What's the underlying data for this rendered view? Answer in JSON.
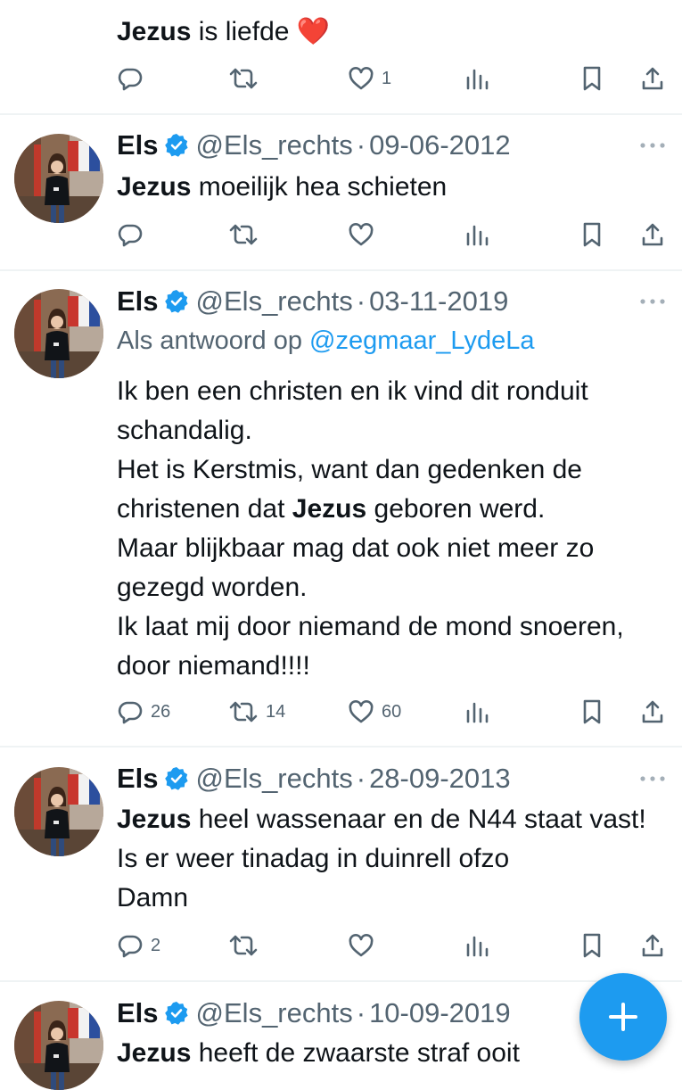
{
  "tweets": [
    {
      "text_parts": [
        {
          "b": "Jezus"
        },
        {
          "t": " is liefde "
        }
      ],
      "emoji": "❤️",
      "counts": {
        "reply": "",
        "retweet": "",
        "like": "1"
      }
    },
    {
      "name": "Els",
      "handle": "@Els_rechts",
      "dot": "·",
      "date": "09-06-2012",
      "text_parts": [
        {
          "b": "Jezus"
        },
        {
          "t": " moeilijk hea schieten"
        }
      ],
      "counts": {
        "reply": "",
        "retweet": "",
        "like": ""
      }
    },
    {
      "name": "Els",
      "handle": "@Els_rechts",
      "dot": "·",
      "date": "03-11-2019",
      "reply_prefix": "Als antwoord op ",
      "reply_to": "@zegmaar_LydeLa",
      "text_parts": [
        {
          "t": "Ik ben een christen en ik vind dit ronduit schandalig."
        },
        {
          "br": true
        },
        {
          "t": "Het is Kerstmis, want dan gedenken de christenen dat "
        },
        {
          "b": "Jezus"
        },
        {
          "t": " geboren werd."
        },
        {
          "br": true
        },
        {
          "t": "Maar blijkbaar mag dat ook niet meer zo gezegd worden."
        },
        {
          "br": true
        },
        {
          "t": "Ik laat mij door niemand de mond snoeren, door niemand!!!!"
        }
      ],
      "counts": {
        "reply": "26",
        "retweet": "14",
        "like": "60"
      }
    },
    {
      "name": "Els",
      "handle": "@Els_rechts",
      "dot": "·",
      "date": "28-09-2013",
      "text_parts": [
        {
          "b": "Jezus"
        },
        {
          "t": " heel wassenaar en de N44 staat vast! Is er weer tinadag in duinrell ofzo"
        },
        {
          "br": true
        },
        {
          "t": "Damn"
        }
      ],
      "counts": {
        "reply": "2",
        "retweet": "",
        "like": ""
      }
    },
    {
      "name": "Els",
      "handle": "@Els_rechts",
      "dot": "·",
      "date": "10-09-2019",
      "text_parts": [
        {
          "b": "Jezus"
        },
        {
          "t": " heeft de zwaarste straf ooit"
        }
      ],
      "counts": {
        "reply": "",
        "retweet": "",
        "like": ""
      }
    }
  ],
  "icons": {
    "reply": "reply-icon",
    "retweet": "retweet-icon",
    "like": "heart-icon",
    "views": "views-icon",
    "bookmark": "bookmark-icon",
    "share": "share-icon",
    "verified": "verified-badge-icon",
    "more": "more-icon",
    "compose": "compose-plus-icon"
  },
  "colors": {
    "accent": "#1d9bf0",
    "text": "#0f1419",
    "muted": "#536471",
    "separator": "#eff3f4"
  }
}
